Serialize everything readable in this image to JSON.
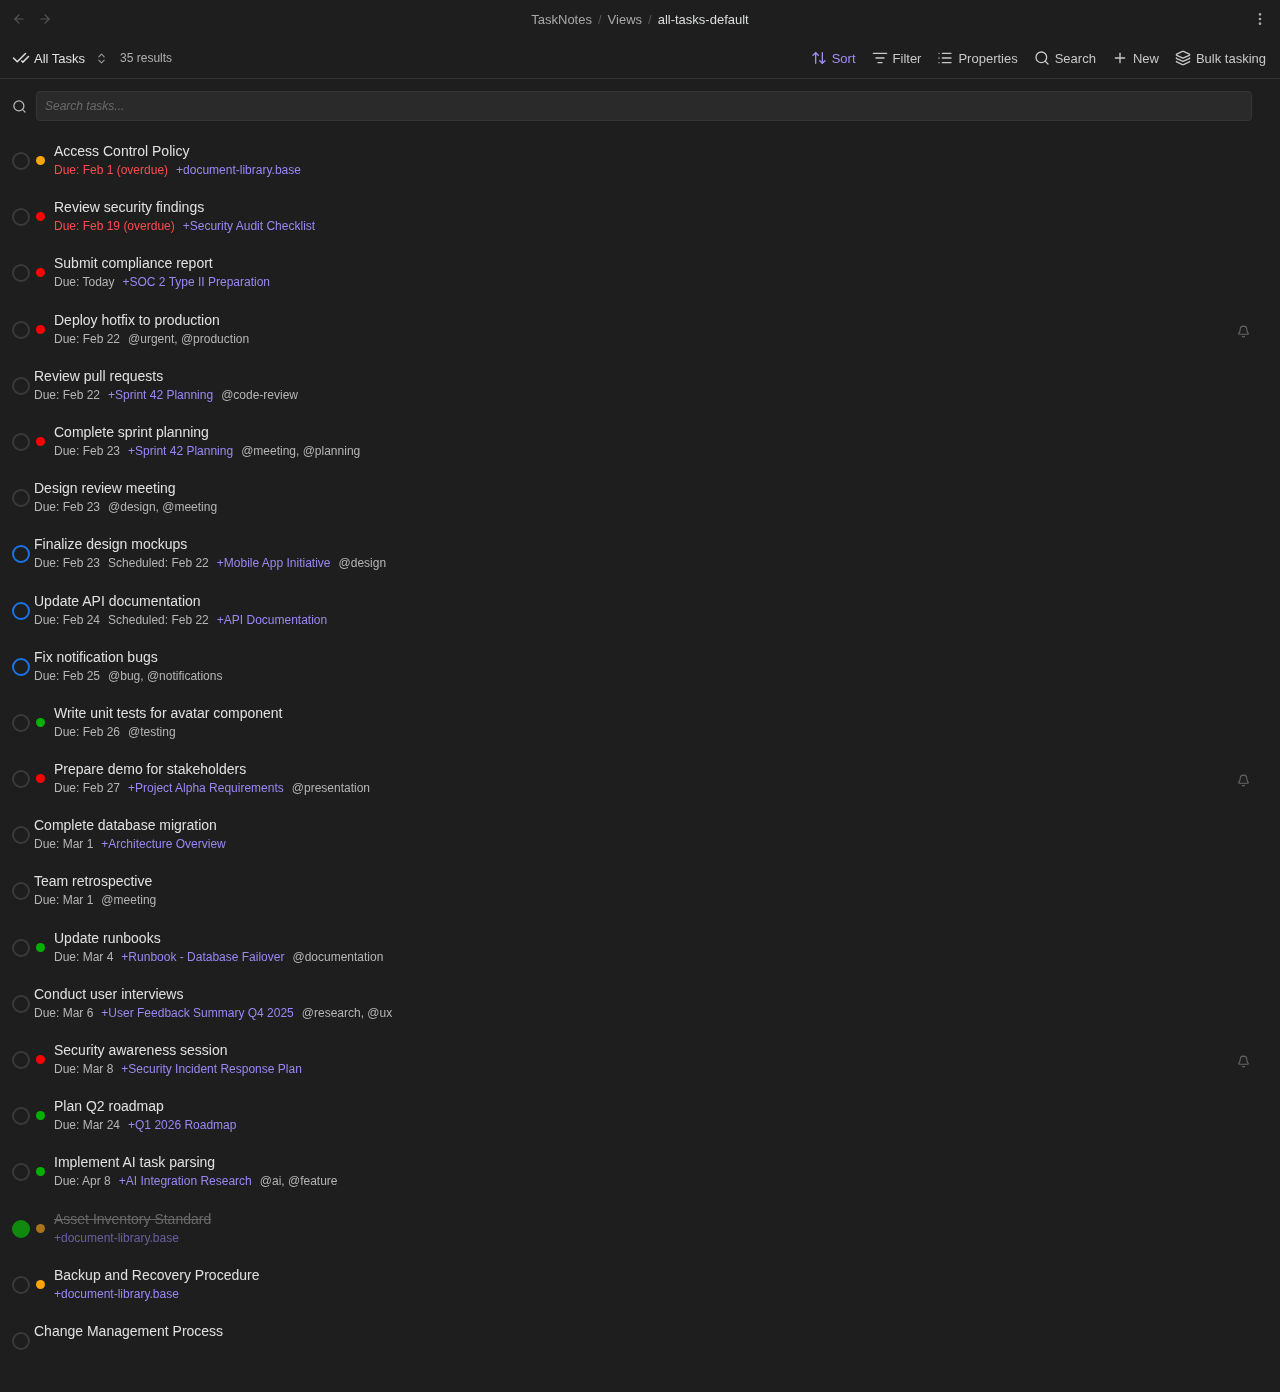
{
  "breadcrumb": [
    "TaskNotes",
    "Views",
    "all-tasks-default"
  ],
  "breadcrumb_separator": "/",
  "view": {
    "title": "All Tasks",
    "count": "35 results"
  },
  "toolbar": [
    {
      "kind": "sort",
      "label": "Sort",
      "active": true
    },
    {
      "kind": "filter",
      "label": "Filter",
      "active": false
    },
    {
      "kind": "properties",
      "label": "Properties",
      "active": false
    },
    {
      "kind": "search",
      "label": "Search",
      "active": false
    },
    {
      "kind": "new",
      "label": "New",
      "active": false
    },
    {
      "kind": "bulk",
      "label": "Bulk tasking",
      "active": false
    }
  ],
  "search": {
    "placeholder": "Search tasks..."
  },
  "tasks": [
    {
      "title": "Access Control Policy",
      "kind": "open",
      "color": "#ffa500",
      "reminder": false,
      "meta": [
        {
          "kind": "due",
          "text": "Due: Feb 1 (overdue)",
          "overdue": true
        },
        {
          "kind": "project",
          "text": "+document-library.base"
        }
      ]
    },
    {
      "title": "Review security findings",
      "kind": "open",
      "color": "#ff0000",
      "reminder": false,
      "meta": [
        {
          "kind": "due",
          "text": "Due: Feb 19 (overdue)",
          "overdue": true
        },
        {
          "kind": "project",
          "text": "+Security Audit Checklist"
        }
      ]
    },
    {
      "title": "Submit compliance report",
      "kind": "open",
      "color": "#ff0000",
      "reminder": false,
      "meta": [
        {
          "kind": "due",
          "text": "Due: Today",
          "overdue": false
        },
        {
          "kind": "project",
          "text": "+SOC 2 Type II Preparation"
        }
      ]
    },
    {
      "title": "Deploy hotfix to production",
      "kind": "open",
      "color": "#ff0000",
      "reminder": true,
      "meta": [
        {
          "kind": "due",
          "text": "Due: Feb 22",
          "overdue": false
        },
        {
          "kind": "tags",
          "text": "@urgent, @production"
        }
      ]
    },
    {
      "title": "Review pull requests",
      "kind": "open",
      "reminder": false,
      "meta": [
        {
          "kind": "due",
          "text": "Due: Feb 22",
          "overdue": false
        },
        {
          "kind": "project",
          "text": "+Sprint 42 Planning"
        },
        {
          "kind": "tags",
          "text": "@code-review"
        }
      ]
    },
    {
      "title": "Complete sprint planning",
      "kind": "open",
      "color": "#ff0000",
      "reminder": false,
      "meta": [
        {
          "kind": "due",
          "text": "Due: Feb 23",
          "overdue": false
        },
        {
          "kind": "project",
          "text": "+Sprint 42 Planning"
        },
        {
          "kind": "tags",
          "text": "@meeting, @planning"
        }
      ]
    },
    {
      "title": "Design review meeting",
      "kind": "open",
      "reminder": false,
      "meta": [
        {
          "kind": "due",
          "text": "Due: Feb 23",
          "overdue": false
        },
        {
          "kind": "tags",
          "text": "@design, @meeting"
        }
      ]
    },
    {
      "title": "Finalize design mockups",
      "kind": "in-progress",
      "reminder": false,
      "meta": [
        {
          "kind": "due",
          "text": "Due: Feb 23",
          "overdue": false
        },
        {
          "kind": "scheduled",
          "text": "Scheduled: Feb 22"
        },
        {
          "kind": "project",
          "text": "+Mobile App Initiative"
        },
        {
          "kind": "tags",
          "text": "@design"
        }
      ]
    },
    {
      "title": "Update API documentation",
      "kind": "in-progress",
      "reminder": false,
      "meta": [
        {
          "kind": "due",
          "text": "Due: Feb 24",
          "overdue": false
        },
        {
          "kind": "scheduled",
          "text": "Scheduled: Feb 22"
        },
        {
          "kind": "project",
          "text": "+API Documentation"
        }
      ]
    },
    {
      "title": "Fix notification bugs",
      "kind": "in-progress",
      "reminder": false,
      "meta": [
        {
          "kind": "due",
          "text": "Due: Feb 25",
          "overdue": false
        },
        {
          "kind": "tags",
          "text": "@bug, @notifications"
        }
      ]
    },
    {
      "title": "Write unit tests for avatar component",
      "kind": "open",
      "color": "#00b000",
      "reminder": false,
      "meta": [
        {
          "kind": "due",
          "text": "Due: Feb 26",
          "overdue": false
        },
        {
          "kind": "tags",
          "text": "@testing"
        }
      ]
    },
    {
      "title": "Prepare demo for stakeholders",
      "kind": "open",
      "color": "#ff0000",
      "reminder": true,
      "meta": [
        {
          "kind": "due",
          "text": "Due: Feb 27",
          "overdue": false
        },
        {
          "kind": "project",
          "text": "+Project Alpha Requirements"
        },
        {
          "kind": "tags",
          "text": "@presentation"
        }
      ]
    },
    {
      "title": "Complete database migration",
      "kind": "open",
      "reminder": false,
      "meta": [
        {
          "kind": "due",
          "text": "Due: Mar 1",
          "overdue": false
        },
        {
          "kind": "project",
          "text": "+Architecture Overview"
        }
      ]
    },
    {
      "title": "Team retrospective",
      "kind": "open",
      "reminder": false,
      "meta": [
        {
          "kind": "due",
          "text": "Due: Mar 1",
          "overdue": false
        },
        {
          "kind": "tags",
          "text": "@meeting"
        }
      ]
    },
    {
      "title": "Update runbooks",
      "kind": "open",
      "color": "#00b000",
      "reminder": false,
      "meta": [
        {
          "kind": "due",
          "text": "Due: Mar 4",
          "overdue": false
        },
        {
          "kind": "project",
          "text": "+Runbook - Database Failover"
        },
        {
          "kind": "tags",
          "text": "@documentation"
        }
      ]
    },
    {
      "title": "Conduct user interviews",
      "kind": "open",
      "reminder": false,
      "meta": [
        {
          "kind": "due",
          "text": "Due: Mar 6",
          "overdue": false
        },
        {
          "kind": "project",
          "text": "+User Feedback Summary Q4 2025"
        },
        {
          "kind": "tags",
          "text": "@research, @ux"
        }
      ]
    },
    {
      "title": "Security awareness session",
      "kind": "open",
      "color": "#ff0000",
      "reminder": true,
      "meta": [
        {
          "kind": "due",
          "text": "Due: Mar 8",
          "overdue": false
        },
        {
          "kind": "project",
          "text": "+Security Incident Response Plan"
        }
      ]
    },
    {
      "title": "Plan Q2 roadmap",
      "kind": "open",
      "color": "#00b000",
      "reminder": false,
      "meta": [
        {
          "kind": "due",
          "text": "Due: Mar 24",
          "overdue": false
        },
        {
          "kind": "project",
          "text": "+Q1 2026 Roadmap"
        }
      ]
    },
    {
      "title": "Implement AI task parsing",
      "kind": "open",
      "color": "#00b000",
      "reminder": false,
      "meta": [
        {
          "kind": "due",
          "text": "Due: Apr 8",
          "overdue": false
        },
        {
          "kind": "project",
          "text": "+AI Integration Research"
        },
        {
          "kind": "tags",
          "text": "@ai, @feature"
        }
      ]
    },
    {
      "title": "Asset Inventory Standard",
      "kind": "done",
      "color": "#a8731a",
      "reminder": false,
      "meta": [
        {
          "kind": "project",
          "text": "+document-library.base"
        }
      ]
    },
    {
      "title": "Backup and Recovery Procedure",
      "kind": "open",
      "color": "#ffa500",
      "reminder": false,
      "meta": [
        {
          "kind": "project",
          "text": "+document-library.base"
        }
      ]
    },
    {
      "title": "Change Management Process",
      "kind": "open",
      "reminder": false
    }
  ]
}
